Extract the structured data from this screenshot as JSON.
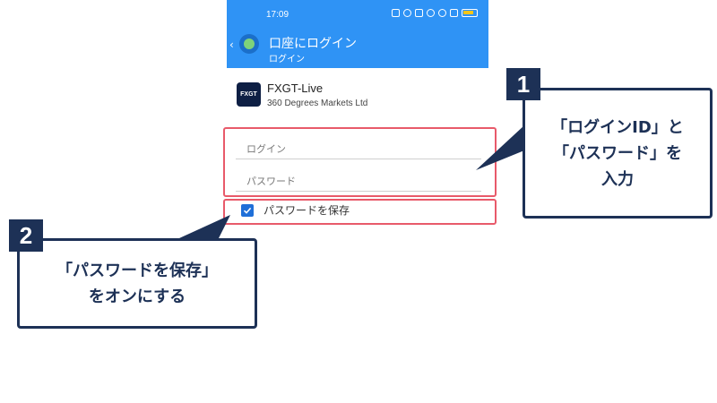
{
  "status_bar": {
    "time": "17:09"
  },
  "app_bar": {
    "title": "口座にログイン",
    "subtitle": "ログイン"
  },
  "server": {
    "logo_text": "FXGT",
    "name": "FXGT-Live",
    "company": "360 Degrees Markets Ltd"
  },
  "form": {
    "login_placeholder": "ログイン",
    "password_placeholder": "パスワード",
    "save_password_label": "パスワードを保存",
    "save_password_checked": true
  },
  "callouts": [
    {
      "number": "1",
      "lines": [
        "「ログインID」と",
        "「パスワード」を",
        "入力"
      ]
    },
    {
      "number": "2",
      "lines": [
        "「パスワードを保存」",
        "をオンにする"
      ]
    }
  ],
  "colors": {
    "appbar": "#2f93f5",
    "highlight": "#e85a6a",
    "callout": "#1d3156",
    "checkbox": "#1f6fd8"
  }
}
